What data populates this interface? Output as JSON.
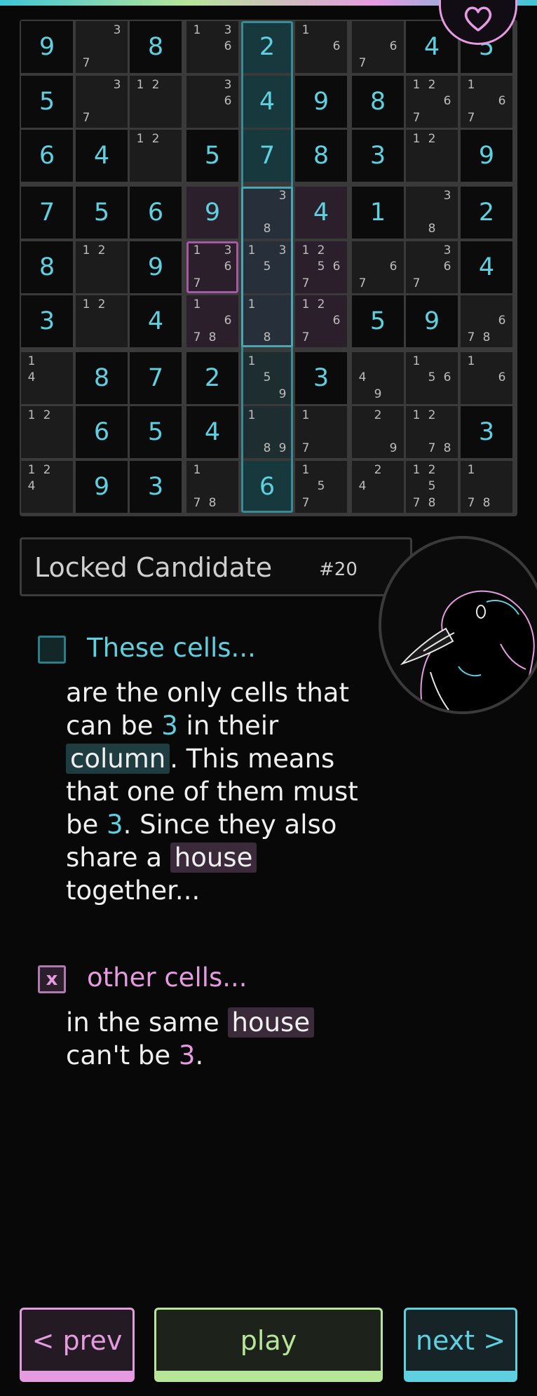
{
  "colors": {
    "accent_cyan": "#5fd0e0",
    "accent_pink": "#e59be0",
    "accent_green": "#b7e59a"
  },
  "grid": [
    [
      {
        "v": "9"
      },
      {
        "c": [
          "",
          "",
          "3",
          "",
          "",
          "",
          "7",
          "",
          ""
        ]
      },
      {
        "v": "8"
      },
      {
        "c": [
          "1",
          "",
          "3",
          "",
          "",
          "6",
          "",
          "",
          ""
        ]
      },
      {
        "v": "2",
        "col": true
      },
      {
        "c": [
          "1",
          "",
          "",
          "",
          "",
          "6",
          "",
          "",
          ""
        ]
      },
      {
        "c": [
          "",
          "",
          "",
          "",
          "",
          "6",
          "7",
          "",
          ""
        ]
      },
      {
        "v": "4"
      },
      {
        "v": "5"
      }
    ],
    [
      {
        "v": "5"
      },
      {
        "c": [
          "",
          "",
          "3",
          "",
          "",
          "",
          "7",
          "",
          ""
        ]
      },
      {
        "c": [
          "1",
          "2",
          "",
          "",
          "",
          "",
          "",
          "",
          ""
        ]
      },
      {
        "c": [
          "",
          "",
          "3",
          "",
          "",
          "6",
          "",
          "",
          ""
        ]
      },
      {
        "v": "4",
        "col": true
      },
      {
        "v": "9"
      },
      {
        "v": "8"
      },
      {
        "c": [
          "1",
          "2",
          "",
          "",
          "",
          "6",
          "7",
          "",
          ""
        ]
      },
      {
        "c": [
          "1",
          "",
          "",
          "",
          "",
          "6",
          "7",
          "",
          ""
        ]
      }
    ],
    [
      {
        "v": "6"
      },
      {
        "v": "4"
      },
      {
        "c": [
          "1",
          "2",
          "",
          "",
          "",
          "",
          "",
          "",
          ""
        ]
      },
      {
        "v": "5"
      },
      {
        "v": "7",
        "col": true
      },
      {
        "v": "8"
      },
      {
        "v": "3"
      },
      {
        "c": [
          "1",
          "2",
          "",
          "",
          "",
          "",
          "",
          "",
          ""
        ]
      },
      {
        "v": "9"
      }
    ],
    [
      {
        "v": "7"
      },
      {
        "v": "5"
      },
      {
        "v": "6"
      },
      {
        "v": "9",
        "house": true
      },
      {
        "c": [
          "",
          "",
          "3",
          "",
          "",
          "",
          "",
          "8",
          ""
        ],
        "col": true,
        "house": true
      },
      {
        "v": "4",
        "house": true
      },
      {
        "v": "1"
      },
      {
        "c": [
          "",
          "",
          "3",
          "",
          "",
          "",
          "",
          "8",
          ""
        ]
      },
      {
        "v": "2"
      }
    ],
    [
      {
        "v": "8"
      },
      {
        "c": [
          "1",
          "2",
          "",
          "",
          "",
          "",
          "",
          "",
          ""
        ]
      },
      {
        "v": "9"
      },
      {
        "c": [
          "1",
          "",
          "3",
          "",
          "",
          "6",
          "7",
          "",
          ""
        ],
        "house": true
      },
      {
        "c": [
          "1",
          "",
          "3",
          "",
          "5",
          "",
          "",
          "",
          ""
        ],
        "col": true,
        "house": true
      },
      {
        "c": [
          "1",
          "2",
          "",
          "",
          "5",
          "6",
          "7",
          "",
          ""
        ],
        "house": true
      },
      {
        "c": [
          "",
          "",
          "",
          "",
          "",
          "6",
          "7",
          "",
          ""
        ]
      },
      {
        "c": [
          "",
          "",
          "3",
          "",
          "",
          "6",
          "7",
          "",
          ""
        ]
      },
      {
        "v": "4"
      }
    ],
    [
      {
        "v": "3"
      },
      {
        "c": [
          "1",
          "2",
          "",
          "",
          "",
          "",
          "",
          "",
          ""
        ]
      },
      {
        "v": "4"
      },
      {
        "c": [
          "1",
          "",
          "",
          "",
          "",
          "6",
          "7",
          "8",
          ""
        ],
        "house": true
      },
      {
        "c": [
          "1",
          "",
          "",
          "",
          "",
          "",
          "",
          "8",
          ""
        ],
        "col": true,
        "house": true
      },
      {
        "c": [
          "1",
          "2",
          "",
          "",
          "",
          "6",
          "7",
          "",
          ""
        ],
        "house": true
      },
      {
        "v": "5"
      },
      {
        "v": "9"
      },
      {
        "c": [
          "",
          "",
          "",
          "",
          "",
          "6",
          "7",
          "8",
          ""
        ]
      }
    ],
    [
      {
        "c": [
          "1",
          "",
          "",
          "4",
          "",
          "",
          "",
          "",
          ""
        ]
      },
      {
        "v": "8"
      },
      {
        "v": "7"
      },
      {
        "v": "2"
      },
      {
        "c": [
          "1",
          "",
          "",
          "",
          "5",
          "",
          "",
          "",
          "9"
        ],
        "col": true
      },
      {
        "v": "3"
      },
      {
        "c": [
          "",
          "",
          "",
          "4",
          "",
          "",
          "",
          "9",
          ""
        ]
      },
      {
        "c": [
          "1",
          "",
          "",
          "",
          "5",
          "6",
          "",
          "",
          ""
        ]
      },
      {
        "c": [
          "1",
          "",
          "",
          "",
          "",
          "6",
          "",
          "",
          ""
        ]
      }
    ],
    [
      {
        "c": [
          "1",
          "2",
          "",
          "",
          "",
          "",
          "",
          "",
          ""
        ]
      },
      {
        "v": "6"
      },
      {
        "v": "5"
      },
      {
        "v": "4"
      },
      {
        "c": [
          "1",
          "",
          "",
          "",
          "",
          "",
          "",
          "8",
          "9"
        ],
        "col": true
      },
      {
        "c": [
          "1",
          "",
          "",
          "",
          "",
          "",
          "7",
          "",
          ""
        ]
      },
      {
        "c": [
          "",
          "2",
          "",
          "",
          "",
          "",
          "",
          "",
          "9"
        ]
      },
      {
        "c": [
          "1",
          "2",
          "",
          "",
          "",
          "",
          "",
          "7",
          "8"
        ]
      },
      {
        "v": "3"
      }
    ],
    [
      {
        "c": [
          "1",
          "2",
          "",
          "4",
          "",
          "",
          "",
          "",
          ""
        ]
      },
      {
        "v": "9"
      },
      {
        "v": "3"
      },
      {
        "c": [
          "1",
          "",
          "",
          "",
          "",
          "",
          "7",
          "8",
          ""
        ]
      },
      {
        "v": "6",
        "col": true
      },
      {
        "c": [
          "1",
          "",
          "",
          "",
          "5",
          "",
          "7",
          "",
          ""
        ]
      },
      {
        "c": [
          "",
          "2",
          "",
          "4",
          "",
          "",
          "",
          "",
          ""
        ]
      },
      {
        "c": [
          "1",
          "2",
          "",
          "",
          "5",
          "",
          "7",
          "8",
          ""
        ]
      },
      {
        "c": [
          "1",
          "",
          "",
          "",
          "",
          "",
          "7",
          "8",
          ""
        ]
      }
    ]
  ],
  "technique": {
    "name": "Locked Candidate",
    "number": "#20"
  },
  "step1": {
    "checkbox": "",
    "heading": "These cells...",
    "t1": "are the only cells that can be ",
    "n1": "3",
    "t2": " in their ",
    "chip1": "column",
    "t3": ". This means that one of them must be ",
    "n2": "3",
    "t4": ". Since they also share a ",
    "chip2": "house",
    "t5": " together..."
  },
  "step2": {
    "checkbox": "x",
    "heading": "other cells...",
    "t1": "in the same ",
    "chip1": "house",
    "t2": " can't be ",
    "n1": "3",
    "t3": "."
  },
  "buttons": {
    "prev": "< prev",
    "play": "play",
    "next": "next >"
  }
}
